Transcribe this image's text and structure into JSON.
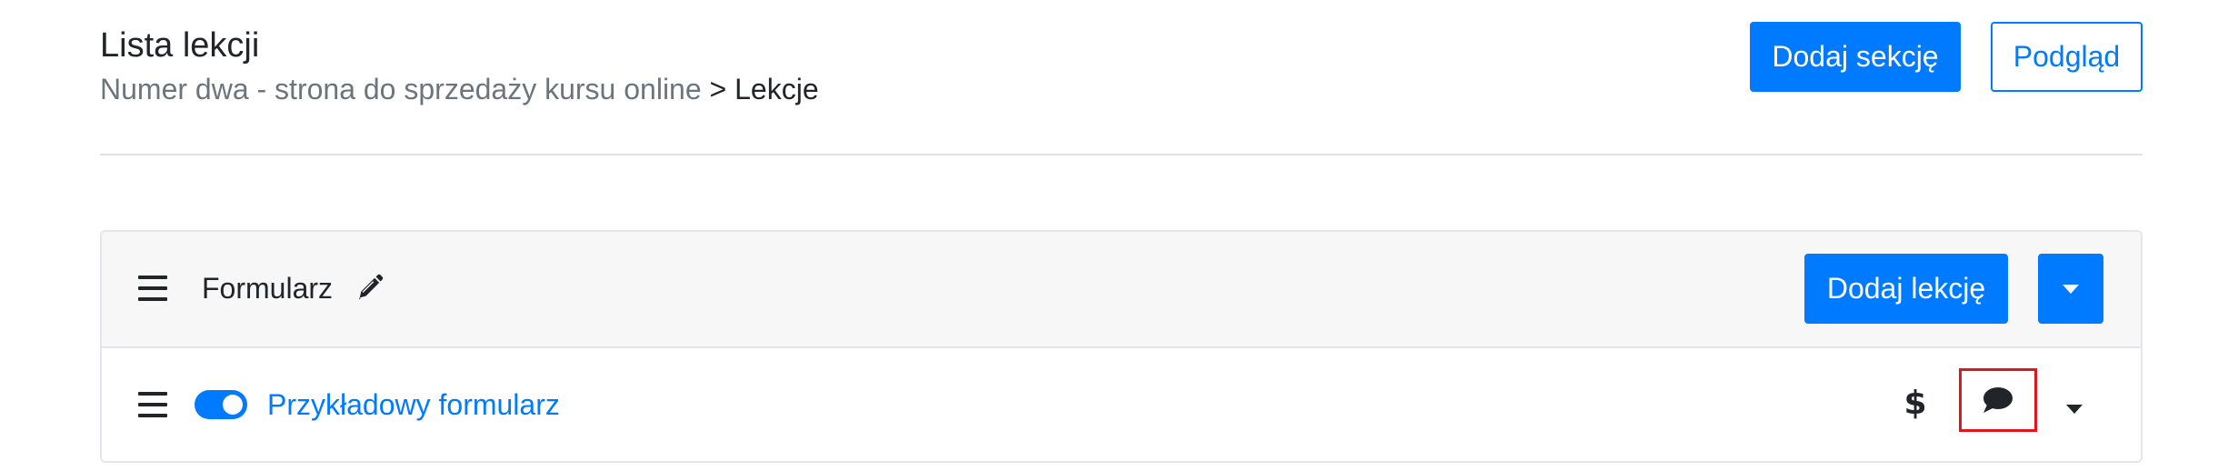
{
  "header": {
    "title": "Lista lekcji",
    "breadcrumb": {
      "parent": "Numer dwa - strona do sprzedaży kursu online",
      "separator": " > ",
      "current": "Lekcje"
    },
    "add_section_label": "Dodaj sekcję",
    "preview_label": "Podgląd"
  },
  "section": {
    "title": "Formularz",
    "add_lesson_label": "Dodaj lekcję",
    "icons": {
      "drag": "drag-handle-icon",
      "edit": "pencil-icon",
      "menu": "chevron-down-icon"
    },
    "lessons": [
      {
        "title": "Przykładowy formularz",
        "published": true,
        "icons": [
          "dollar-icon",
          "comment-icon",
          "chevron-down-icon"
        ]
      }
    ]
  },
  "colors": {
    "primary": "#007bff",
    "muted": "#6c757d",
    "text": "#212529",
    "highlight": "#e0161f",
    "card_header_bg": "#f7f7f7"
  }
}
